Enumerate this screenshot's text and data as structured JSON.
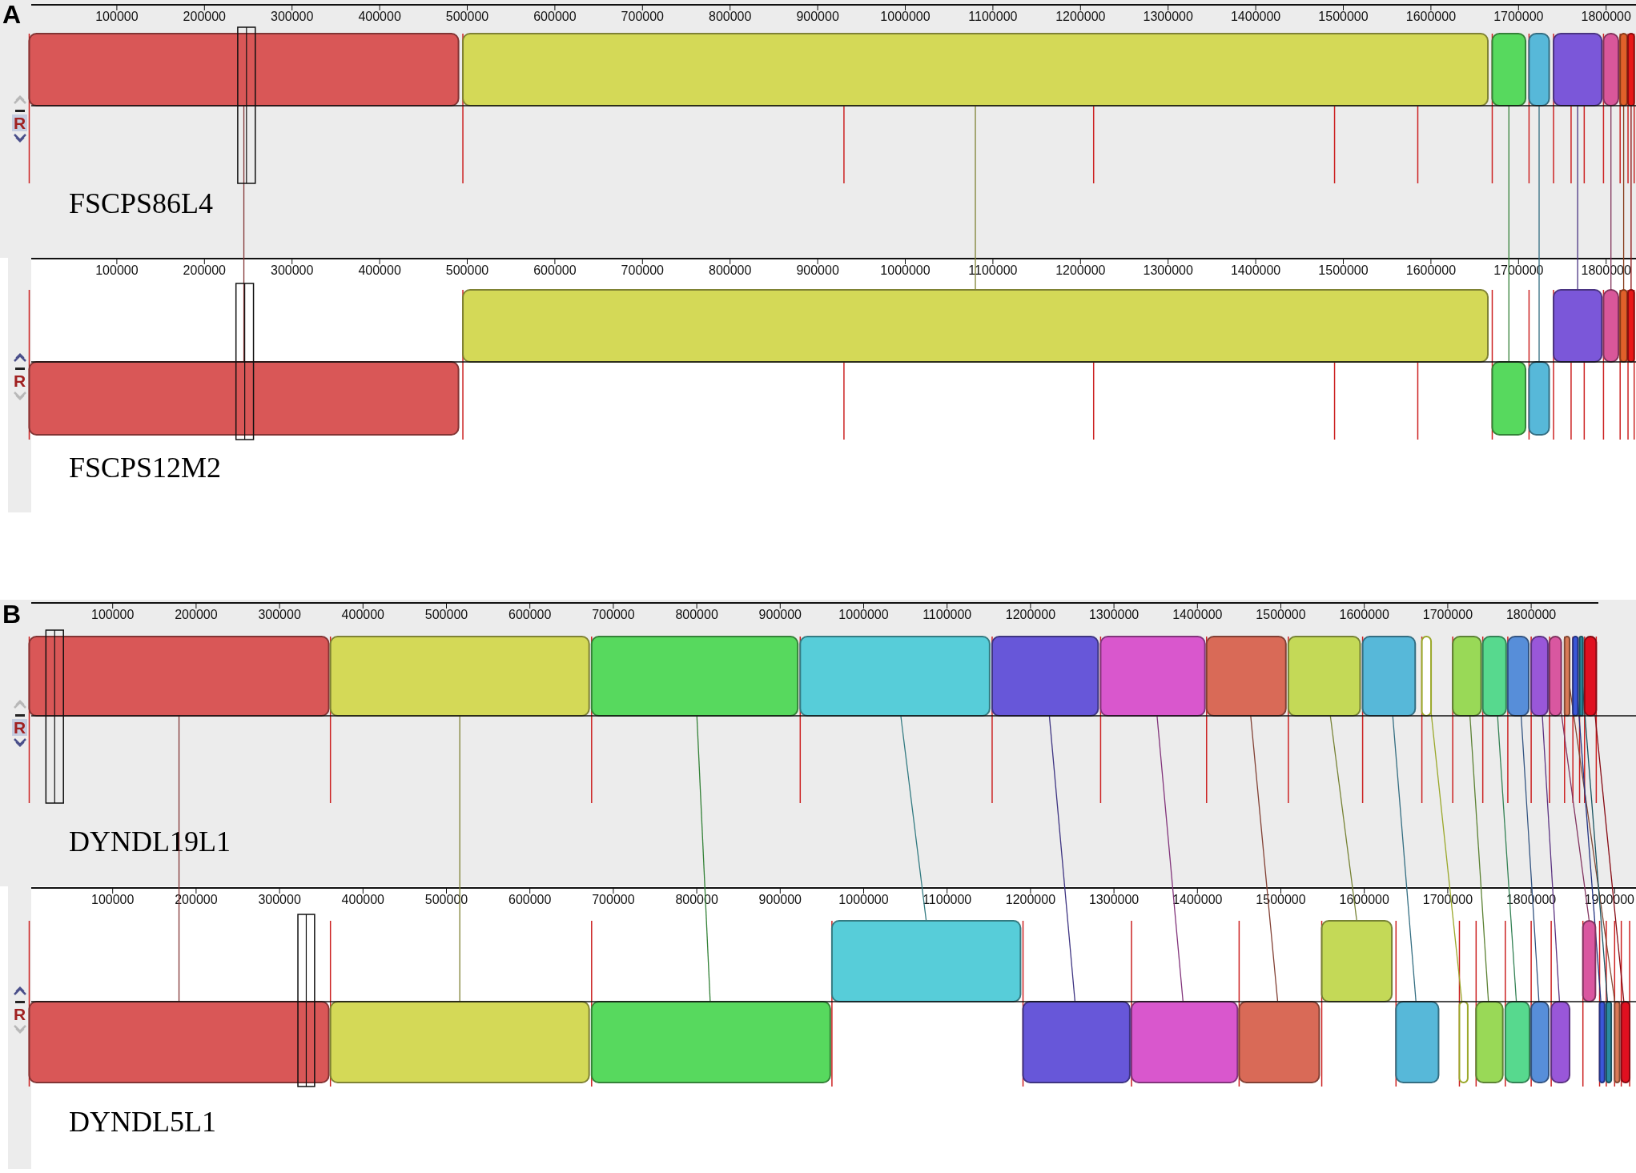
{
  "panels": [
    {
      "label": "A",
      "genomes": [
        {
          "name": "FSCPS86L4",
          "reference_mark": "R",
          "reference": true,
          "up_disabled": true,
          "down_disabled": false,
          "ruler_ticks": [
            "100000",
            "200000",
            "300000",
            "400000",
            "500000",
            "600000",
            "700000",
            "800000",
            "900000",
            "1000000",
            "1100000",
            "1200000",
            "1300000",
            "1400000",
            "1500000",
            "1600000",
            "1700000",
            "1800000"
          ]
        },
        {
          "name": "FSCPS12M2",
          "reference_mark": "R",
          "reference": false,
          "up_disabled": false,
          "down_disabled": true,
          "ruler_ticks": [
            "100000",
            "200000",
            "300000",
            "400000",
            "500000",
            "600000",
            "700000",
            "800000",
            "900000",
            "1000000",
            "1100000",
            "1200000",
            "1300000",
            "1400000",
            "1500000",
            "1600000",
            "1700000",
            "1800000"
          ]
        }
      ]
    },
    {
      "label": "B",
      "genomes": [
        {
          "name": "DYNDL19L1",
          "reference_mark": "R",
          "reference": true,
          "up_disabled": true,
          "down_disabled": false,
          "ruler_ticks": [
            "100000",
            "200000",
            "300000",
            "400000",
            "500000",
            "600000",
            "700000",
            "800000",
            "900000",
            "1000000",
            "1100000",
            "1200000",
            "1300000",
            "1400000",
            "1500000",
            "1600000",
            "1700000",
            "1800000"
          ]
        },
        {
          "name": "DYNDL5L1",
          "reference_mark": "R",
          "reference": false,
          "up_disabled": false,
          "down_disabled": true,
          "ruler_ticks": [
            "100000",
            "200000",
            "300000",
            "400000",
            "500000",
            "600000",
            "700000",
            "800000",
            "900000",
            "1000000",
            "1100000",
            "1200000",
            "1300000",
            "1400000",
            "1500000",
            "1600000",
            "1700000",
            "1800000",
            "1900000"
          ]
        }
      ]
    }
  ]
}
